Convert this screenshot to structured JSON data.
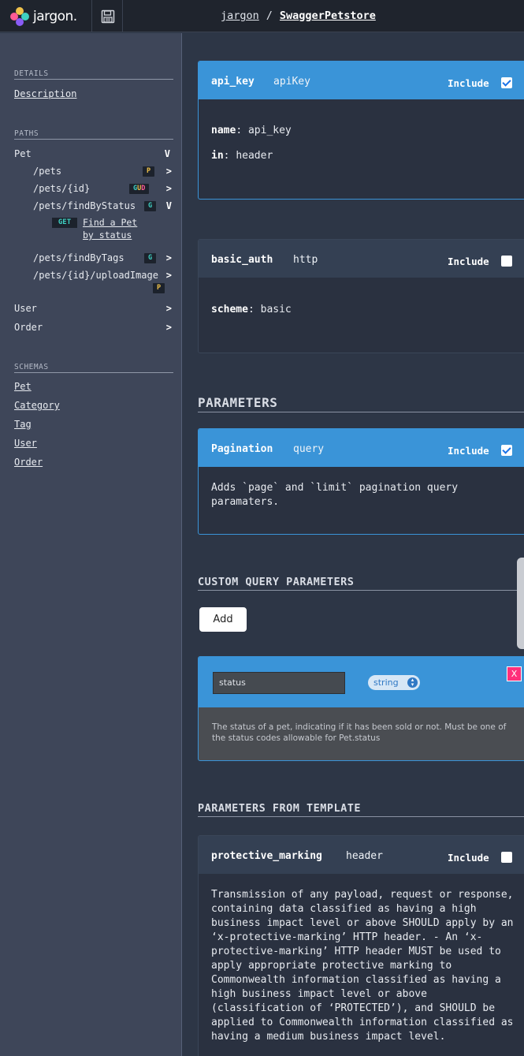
{
  "header": {
    "logo_text": "jargon.",
    "breadcrumb": {
      "project": "jargon",
      "separator": "/",
      "api": "SwaggerPetstore"
    },
    "save_icon": "floppy-disk-icon"
  },
  "sidebar": {
    "details_heading": "DETAILS",
    "description_link": "Description",
    "paths_heading": "PATHS",
    "pet_group": {
      "label": "Pet",
      "chevron": "V"
    },
    "paths": [
      {
        "path": "/pets",
        "badge": "P",
        "chevron": ">"
      },
      {
        "path": "/pets/{id}",
        "badge_g": "G",
        "badge_u": "U",
        "badge_d": "D",
        "chevron": ">"
      },
      {
        "path": "/pets/findByStatus",
        "badge": "G",
        "chevron": "V"
      },
      {
        "path": "/pets/findByTags",
        "badge": "G",
        "chevron": ">"
      },
      {
        "path": "/pets/{id}/uploadImage",
        "badge": "P",
        "chevron": ">"
      }
    ],
    "operation": {
      "method": "GET",
      "line1": "Find a Pet",
      "line2": "by status"
    },
    "user_group": {
      "label": "User",
      "chevron": ">"
    },
    "order_group": {
      "label": "Order",
      "chevron": ">"
    },
    "schemas_heading": "SCHEMAS",
    "schemas": [
      "Pet",
      "Category",
      "Tag",
      "User",
      "Order"
    ]
  },
  "security": [
    {
      "name": "api_key",
      "type": "apiKey",
      "include_label": "Include",
      "checked": true,
      "fields": [
        {
          "key": "name",
          "value": "api_key"
        },
        {
          "key": "in",
          "value": "header"
        }
      ]
    },
    {
      "name": "basic_auth",
      "type": "http",
      "include_label": "Include",
      "checked": false,
      "fields": [
        {
          "key": "scheme",
          "value": "basic"
        }
      ]
    }
  ],
  "parameters": {
    "heading": "PARAMETERS",
    "items": [
      {
        "name": "Pagination",
        "type": "query",
        "include_label": "Include",
        "checked": true,
        "description": "Adds `page` and `limit` pagination query paramaters."
      }
    ]
  },
  "custom_query": {
    "heading": "CUSTOM QUERY PARAMETERS",
    "add_label": "Add",
    "param": {
      "name_value": "status",
      "type_value": "string",
      "remove_label": "X",
      "description": "The status of a pet, indicating if it has been sold or not. Must be one of the status codes allowable for Pet.status"
    }
  },
  "template_params": {
    "heading": "PARAMETERS FROM TEMPLATE",
    "items": [
      {
        "name": "protective_marking",
        "type": "header",
        "include_label": "Include",
        "checked": false,
        "description": "Transmission of any payload, request or response, containing data classified as having a high business impact level or above SHOULD apply by an ‘x-protective-marking’ HTTP header. - An ‘x-protective-marking’ HTTP header MUST be used to apply appropriate protective marking to Commonwealth information classified as having a high business impact level or above (classification of ‘PROTECTED’), and SHOULD be applied to Commonwealth information classified as having a medium business impact level."
      }
    ]
  },
  "colors": {
    "accent": "#3a94d8",
    "sidebar_bg": "#3e4659",
    "main_bg": "#2d3646",
    "badge_post": "#f0c24b",
    "badge_get": "#3fd0c2",
    "badge_delete": "#ff5b95",
    "remove_button": "#ff2f7a"
  }
}
